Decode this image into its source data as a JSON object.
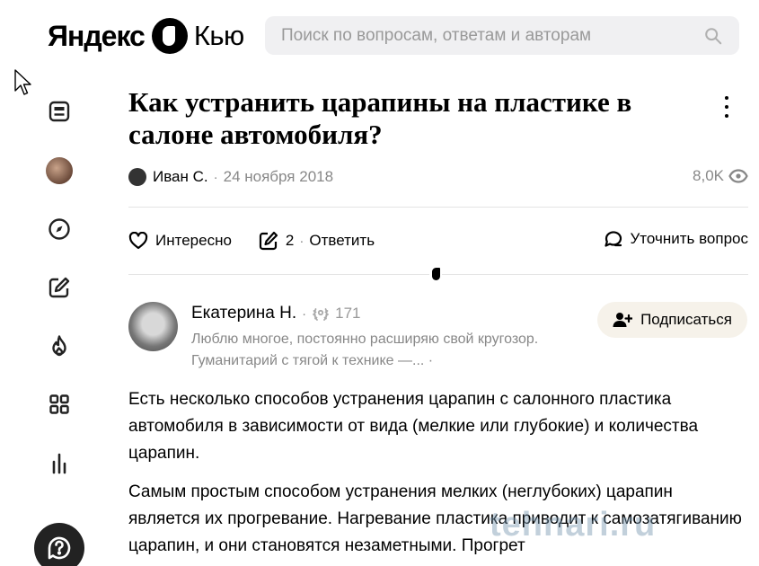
{
  "header": {
    "logo_yandex": "Яндекс",
    "logo_kyu": "Кью",
    "search_placeholder": "Поиск по вопросам, ответам и авторам"
  },
  "sidebar": {
    "items": [
      {
        "icon": "feed-icon"
      },
      {
        "icon": "profile-avatar"
      },
      {
        "icon": "compass-icon"
      },
      {
        "icon": "edit-icon"
      },
      {
        "icon": "fire-icon"
      },
      {
        "icon": "grid-icon"
      },
      {
        "icon": "stats-icon"
      }
    ],
    "help_icon": "question-icon"
  },
  "question": {
    "title": "Как устранить царапины на пластике в салоне автомобиля?",
    "author": "Иван С.",
    "date": "24 ноября 2018",
    "views": "8,0K",
    "actions": {
      "interesting": "Интересно",
      "answers_count": "2",
      "reply": "Ответить",
      "clarify": "Уточнить вопрос"
    }
  },
  "answer": {
    "author": "Екатерина Н.",
    "rating": "171",
    "bio_line1": "Люблю многое, постоянно расширяю свой кругозор.",
    "bio_line2": "Гуманитарий с тягой к технике —...",
    "follow": "Подписаться",
    "paragraphs": [
      "Есть несколько способов устранения царапин с салонного пластика автомобиля в зависимости от вида (мелкие или глубокие) и количества царапин.",
      "Самым простым способом устранения мелких (неглубоких) царапин является их прогревание. Нагревание пластика приводит к самозатягиванию царапин, и они становятся незаметными. Прогрет"
    ]
  },
  "watermark": "tehnari.ru",
  "colors": {
    "muted": "#888888",
    "search_bg": "#f0f0f2",
    "follow_bg": "#f6f2ea"
  }
}
